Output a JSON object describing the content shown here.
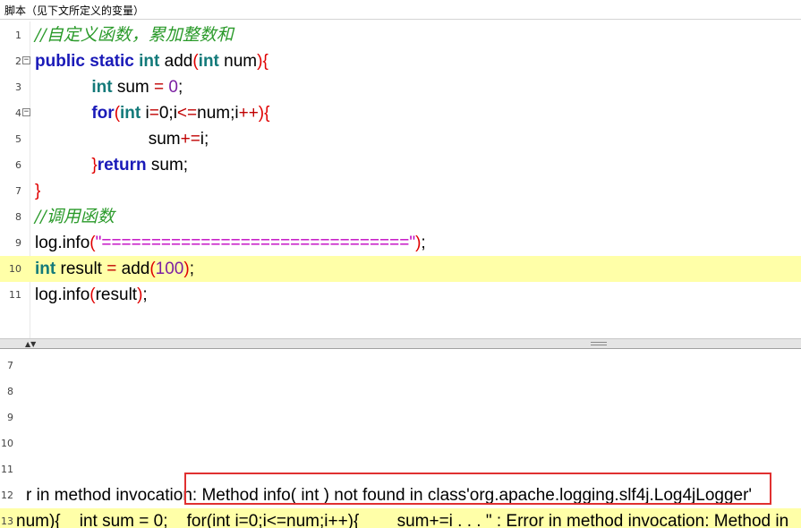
{
  "window": {
    "title": "脚本（见下文所定义的变量）"
  },
  "editor": {
    "current_line": 10,
    "lines": [
      {
        "n": "1",
        "fold": "",
        "parts": [
          [
            "cm",
            "//自定义函数，累加整数和"
          ]
        ]
      },
      {
        "n": "2",
        "fold": "⊟",
        "parts": [
          [
            "kw",
            "public static "
          ],
          [
            "ty",
            "int"
          ],
          [
            "",
            " add"
          ],
          [
            "br",
            "("
          ],
          [
            "ty",
            "int"
          ],
          [
            "",
            " num"
          ],
          [
            "br",
            "){"
          ]
        ]
      },
      {
        "n": "3",
        "fold": "",
        "parts": [
          [
            "",
            "            "
          ],
          [
            "ty",
            "int"
          ],
          [
            "",
            " sum "
          ],
          [
            "op",
            "="
          ],
          [
            "",
            " "
          ],
          [
            "num",
            "0"
          ],
          [
            "",
            ";"
          ]
        ]
      },
      {
        "n": "4",
        "fold": "⊟",
        "parts": [
          [
            "",
            "            "
          ],
          [
            "kw",
            "for"
          ],
          [
            "br",
            "("
          ],
          [
            "ty",
            "int"
          ],
          [
            "",
            " i"
          ],
          [
            "op",
            "="
          ],
          [
            "",
            "0;i"
          ],
          [
            "op",
            "<="
          ],
          [
            "",
            "num;i"
          ],
          [
            "op",
            "++"
          ],
          [
            "br",
            "){"
          ]
        ]
      },
      {
        "n": "5",
        "fold": "",
        "parts": [
          [
            "",
            "                        sum"
          ],
          [
            "op",
            "+="
          ],
          [
            "",
            "i;"
          ]
        ]
      },
      {
        "n": "6",
        "fold": "",
        "parts": [
          [
            "",
            "            "
          ],
          [
            "br",
            "}"
          ],
          [
            "kw",
            "return"
          ],
          [
            "",
            " sum;"
          ]
        ]
      },
      {
        "n": "7",
        "fold": "",
        "parts": [
          [
            "br",
            "}"
          ]
        ]
      },
      {
        "n": "8",
        "fold": "",
        "parts": [
          [
            "cm",
            "//调用函数"
          ]
        ]
      },
      {
        "n": "9",
        "fold": "",
        "parts": [
          [
            "",
            "log.info"
          ],
          [
            "br",
            "("
          ],
          [
            "str",
            "\"===============================\""
          ],
          [
            "br",
            ")"
          ],
          [
            "",
            ";"
          ]
        ]
      },
      {
        "n": "10",
        "fold": "",
        "parts": [
          [
            "ty",
            "int"
          ],
          [
            "",
            " result "
          ],
          [
            "op",
            "="
          ],
          [
            "",
            " add"
          ],
          [
            "br",
            "("
          ],
          [
            "num",
            "100"
          ],
          [
            "br",
            ")"
          ],
          [
            "",
            ";"
          ]
        ]
      },
      {
        "n": "11",
        "fold": "",
        "parts": [
          [
            "",
            "log.info"
          ],
          [
            "br",
            "("
          ],
          [
            "",
            "result"
          ],
          [
            "br",
            ")"
          ],
          [
            "",
            ";"
          ]
        ]
      }
    ]
  },
  "output": {
    "lines": [
      {
        "n": "7",
        "text": ""
      },
      {
        "n": "8",
        "text": ""
      },
      {
        "n": "9",
        "text": ""
      },
      {
        "n": "10",
        "text": ""
      },
      {
        "n": "11",
        "text": ""
      },
      {
        "n": "12",
        "text": "r in method invocation: Method info( int ) not found in class'org.apache.logging.slf4j.Log4jLogger'"
      },
      {
        "n": "13",
        "text": "num){    int sum = 0;    for(int i=0;i<=num;i++){        sum+=i . . . \" : Error in method invocation: Method in"
      }
    ],
    "highlighted_error": "Method info( int ) not found in class'org.apache.logging.slf4j.Log4jLogger'"
  },
  "colors": {
    "current_line": "#ffffa8",
    "keyword": "#1a1ab8",
    "type": "#137a7a",
    "comment": "#2a9a2a",
    "bracket": "#e00000",
    "number": "#7b1fa2",
    "string": "#c000c0",
    "highlight_box": "#e03030"
  },
  "icons": {
    "fold_collapse": "minus-box-icon",
    "splitter_arrows": "up-down-arrows-icon",
    "splitter_grip": "grip-icon"
  }
}
